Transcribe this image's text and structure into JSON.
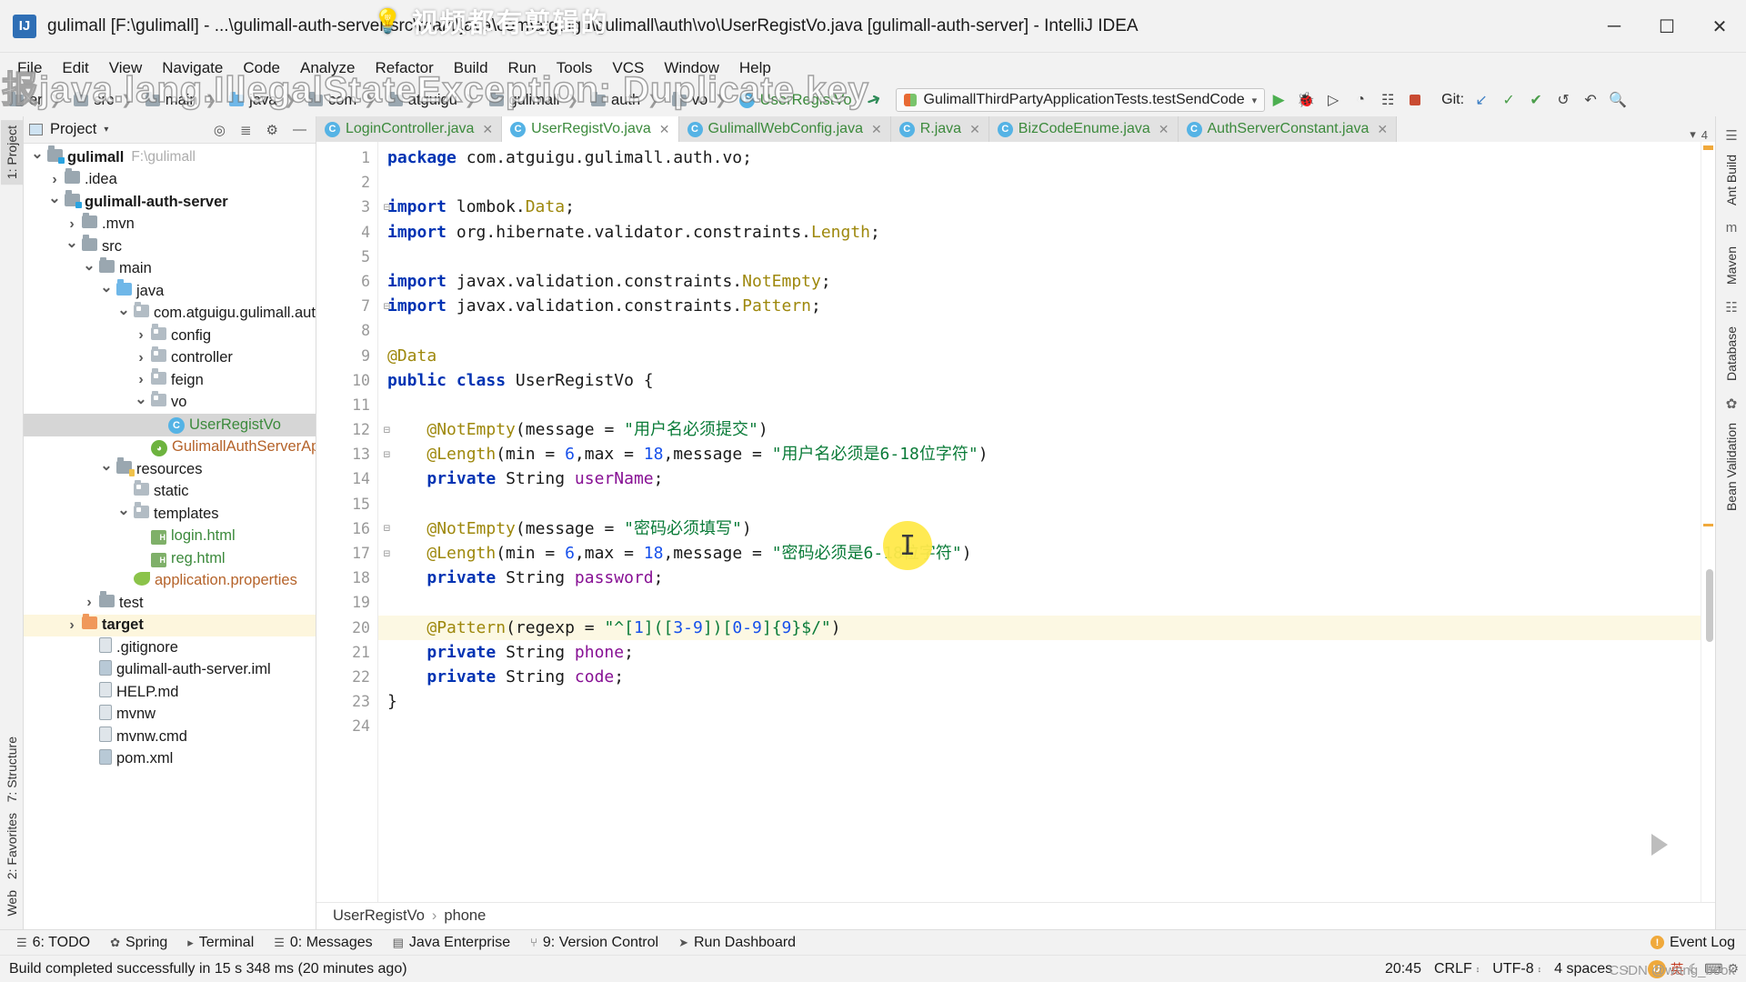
{
  "window": {
    "title": "gulimall [F:\\gulimall] - ...\\gulimall-auth-server\\src\\main\\java\\com\\atguigu\\gulimall\\auth\\vo\\UserRegistVo.java [gulimall-auth-server] - IntelliJ IDEA",
    "minimize": "─",
    "maximize": "☐",
    "close": "✕",
    "app_badge": "IJ"
  },
  "menubar": [
    "File",
    "Edit",
    "View",
    "Navigate",
    "Code",
    "Analyze",
    "Refactor",
    "Build",
    "Run",
    "Tools",
    "VCS",
    "Window",
    "Help"
  ],
  "breadcrumb": {
    "items": [
      {
        "label": "er",
        "icon": "folder-icon",
        "kind": "folder"
      },
      {
        "label": "src",
        "icon": "folder-icon",
        "kind": "folder"
      },
      {
        "label": "main",
        "icon": "folder-icon",
        "kind": "folder"
      },
      {
        "label": "java",
        "icon": "folder-blue-icon",
        "kind": "folder-blue"
      },
      {
        "label": "com",
        "icon": "folder-icon",
        "kind": "folder"
      },
      {
        "label": "atguigu",
        "icon": "folder-icon",
        "kind": "folder"
      },
      {
        "label": "gulimall",
        "icon": "folder-icon",
        "kind": "folder"
      },
      {
        "label": "auth",
        "icon": "folder-icon",
        "kind": "folder"
      },
      {
        "label": "vo",
        "icon": "folder-icon",
        "kind": "folder"
      },
      {
        "label": "UserRegistVo",
        "icon": "java-class-icon",
        "kind": "class"
      }
    ]
  },
  "toolbar": {
    "run_configuration": "GulimallThirdPartyApplicationTests.testSendCode",
    "run_caret": "▾",
    "run_label": "▶",
    "debug_label": "🐞",
    "run_coverage_label": "▷",
    "profile_label": "◔",
    "build_label": "☷",
    "stop_label": "■",
    "git_label": "Git:",
    "git_update_label": "↙",
    "git_commit_label": "✓",
    "git_push_label": "✔",
    "git_history_label": "↺",
    "git_rollback_label": "↶",
    "search_label": "🔍"
  },
  "left_strip": {
    "top_items": [
      "1: Project"
    ],
    "bottom_items": [
      "7: Structure",
      "2: Favorites",
      "Web"
    ]
  },
  "right_strip": {
    "items": [
      "Ant Build",
      "Maven",
      "Database",
      "Bean Validation"
    ]
  },
  "project_panel": {
    "header_title": "Project",
    "header_caret": "▾",
    "locate_icon": "crosshair-icon",
    "collapse_icon": "collapse-all-icon",
    "settings_icon": "gear-icon",
    "hide_icon": "minimize-icon",
    "tree": [
      {
        "label": "gulimall",
        "path": "F:\\gulimall",
        "depth": 0,
        "expand": "down",
        "icon": "module-folder-icon",
        "bold": true,
        "state": "normal"
      },
      {
        "label": ".idea",
        "path": "",
        "depth": 1,
        "expand": "right",
        "icon": "folder-icon",
        "bold": false,
        "state": "normal"
      },
      {
        "label": "gulimall-auth-server",
        "path": "",
        "depth": 1,
        "expand": "down",
        "icon": "module-folder-icon",
        "bold": true,
        "state": "normal"
      },
      {
        "label": ".mvn",
        "path": "",
        "depth": 2,
        "expand": "right",
        "icon": "folder-icon",
        "bold": false,
        "state": "normal"
      },
      {
        "label": "src",
        "path": "",
        "depth": 2,
        "expand": "down",
        "icon": "folder-icon",
        "bold": false,
        "state": "normal"
      },
      {
        "label": "main",
        "path": "",
        "depth": 3,
        "expand": "down",
        "icon": "folder-icon",
        "bold": false,
        "state": "normal"
      },
      {
        "label": "java",
        "path": "",
        "depth": 4,
        "expand": "down",
        "icon": "folder-blue-icon",
        "bold": false,
        "state": "normal"
      },
      {
        "label": "com.atguigu.gulimall.aut",
        "path": "",
        "depth": 5,
        "expand": "down",
        "icon": "package-icon",
        "bold": false,
        "state": "normal"
      },
      {
        "label": "config",
        "path": "",
        "depth": 6,
        "expand": "right",
        "icon": "package-icon",
        "bold": false,
        "state": "normal"
      },
      {
        "label": "controller",
        "path": "",
        "depth": 6,
        "expand": "right",
        "icon": "package-icon",
        "bold": false,
        "state": "normal"
      },
      {
        "label": "feign",
        "path": "",
        "depth": 6,
        "expand": "right",
        "icon": "package-icon",
        "bold": false,
        "state": "normal"
      },
      {
        "label": "vo",
        "path": "",
        "depth": 6,
        "expand": "down",
        "icon": "package-icon",
        "bold": false,
        "state": "normal"
      },
      {
        "label": "UserRegistVo",
        "path": "",
        "depth": 7,
        "expand": "none",
        "icon": "java-class-icon",
        "bold": false,
        "state": "selected"
      },
      {
        "label": "GulimallAuthServerAp",
        "path": "",
        "depth": 6,
        "expand": "none",
        "icon": "spring-boot-icon",
        "bold": false,
        "state": "spring"
      },
      {
        "label": "resources",
        "path": "",
        "depth": 4,
        "expand": "down",
        "icon": "resources-folder-icon",
        "bold": false,
        "state": "normal"
      },
      {
        "label": "static",
        "path": "",
        "depth": 5,
        "expand": "none",
        "icon": "package-icon",
        "bold": false,
        "state": "normal"
      },
      {
        "label": "templates",
        "path": "",
        "depth": 5,
        "expand": "down",
        "icon": "package-icon",
        "bold": false,
        "state": "normal"
      },
      {
        "label": "login.html",
        "path": "",
        "depth": 6,
        "expand": "none",
        "icon": "html-file-icon",
        "bold": false,
        "state": "html"
      },
      {
        "label": "reg.html",
        "path": "",
        "depth": 6,
        "expand": "none",
        "icon": "html-file-icon",
        "bold": false,
        "state": "html"
      },
      {
        "label": "application.properties",
        "path": "",
        "depth": 5,
        "expand": "none",
        "icon": "properties-file-icon",
        "bold": false,
        "state": "props"
      },
      {
        "label": "test",
        "path": "",
        "depth": 3,
        "expand": "right",
        "icon": "folder-icon",
        "bold": false,
        "state": "normal"
      },
      {
        "label": "target",
        "path": "",
        "depth": 2,
        "expand": "right",
        "icon": "folder-orange-icon",
        "bold": true,
        "state": "highlighted"
      },
      {
        "label": ".gitignore",
        "path": "",
        "depth": 3,
        "expand": "none",
        "icon": "file-icon",
        "bold": false,
        "state": "normal"
      },
      {
        "label": "gulimall-auth-server.iml",
        "path": "",
        "depth": 3,
        "expand": "none",
        "icon": "module-file-icon",
        "bold": false,
        "state": "normal"
      },
      {
        "label": "HELP.md",
        "path": "",
        "depth": 3,
        "expand": "none",
        "icon": "markdown-file-icon",
        "bold": false,
        "state": "normal"
      },
      {
        "label": "mvnw",
        "path": "",
        "depth": 3,
        "expand": "none",
        "icon": "file-icon",
        "bold": false,
        "state": "normal"
      },
      {
        "label": "mvnw.cmd",
        "path": "",
        "depth": 3,
        "expand": "none",
        "icon": "file-icon",
        "bold": false,
        "state": "normal"
      },
      {
        "label": "pom.xml",
        "path": "",
        "depth": 3,
        "expand": "none",
        "icon": "maven-file-icon",
        "bold": false,
        "state": "normal"
      }
    ]
  },
  "editor": {
    "tabs": [
      {
        "label": "LoginController.java",
        "active": false,
        "icon": "java-class-icon",
        "closable": true
      },
      {
        "label": "UserRegistVo.java",
        "active": true,
        "icon": "java-class-icon",
        "closable": true
      },
      {
        "label": "GulimallWebConfig.java",
        "active": false,
        "icon": "java-class-icon",
        "closable": true
      },
      {
        "label": "R.java",
        "active": false,
        "icon": "java-class-icon",
        "closable": true
      },
      {
        "label": "BizCodeEnume.java",
        "active": false,
        "icon": "java-class-icon",
        "closable": true
      },
      {
        "label": "AuthServerConstant.java",
        "active": false,
        "icon": "java-class-icon",
        "closable": true
      }
    ],
    "tabs_overflow_caret": "▾",
    "tabs_count_badge": "4",
    "line_numbers": [
      1,
      2,
      3,
      4,
      5,
      6,
      7,
      8,
      9,
      10,
      11,
      12,
      13,
      14,
      15,
      16,
      17,
      18,
      19,
      20,
      21,
      22,
      23,
      24
    ],
    "current_line": 20,
    "code_lines": [
      {
        "n": 1,
        "tokens": [
          {
            "t": "package ",
            "c": "kw"
          },
          {
            "t": "com.atguigu.gulimall.auth.vo;",
            "c": "pk"
          }
        ]
      },
      {
        "n": 2,
        "tokens": []
      },
      {
        "n": 3,
        "tokens": [
          {
            "t": "import ",
            "c": "kw"
          },
          {
            "t": "lombok.",
            "c": "pk"
          },
          {
            "t": "Data",
            "c": "ann"
          },
          {
            "t": ";",
            "c": "pk"
          }
        ],
        "fold": "minus"
      },
      {
        "n": 4,
        "tokens": [
          {
            "t": "import ",
            "c": "kw"
          },
          {
            "t": "org.hibernate.validator.constraints.",
            "c": "pk"
          },
          {
            "t": "Length",
            "c": "ann"
          },
          {
            "t": ";",
            "c": "pk"
          }
        ]
      },
      {
        "n": 5,
        "tokens": []
      },
      {
        "n": 6,
        "tokens": [
          {
            "t": "import ",
            "c": "kw"
          },
          {
            "t": "javax.validation.constraints.",
            "c": "pk"
          },
          {
            "t": "NotEmpty",
            "c": "ann"
          },
          {
            "t": ";",
            "c": "pk"
          }
        ]
      },
      {
        "n": 7,
        "tokens": [
          {
            "t": "import ",
            "c": "kw"
          },
          {
            "t": "javax.validation.constraints.",
            "c": "pk"
          },
          {
            "t": "Pattern",
            "c": "ann"
          },
          {
            "t": ";",
            "c": "pk"
          }
        ],
        "fold": "minus"
      },
      {
        "n": 8,
        "tokens": []
      },
      {
        "n": 9,
        "tokens": [
          {
            "t": "@Data",
            "c": "ann"
          }
        ]
      },
      {
        "n": 10,
        "tokens": [
          {
            "t": "public class ",
            "c": "kw"
          },
          {
            "t": "UserRegistVo",
            "c": "typ"
          },
          {
            "t": " {",
            "c": "pk"
          }
        ]
      },
      {
        "n": 11,
        "tokens": []
      },
      {
        "n": 12,
        "tokens": [
          {
            "t": "    ",
            "c": "pk"
          },
          {
            "t": "@NotEmpty",
            "c": "ann"
          },
          {
            "t": "(message = ",
            "c": "pk"
          },
          {
            "t": "\"用户名必须提交\"",
            "c": "str"
          },
          {
            "t": ")",
            "c": "pk"
          }
        ],
        "fold": "minus"
      },
      {
        "n": 13,
        "tokens": [
          {
            "t": "    ",
            "c": "pk"
          },
          {
            "t": "@Length",
            "c": "ann"
          },
          {
            "t": "(min = ",
            "c": "pk"
          },
          {
            "t": "6",
            "c": "num"
          },
          {
            "t": ",max = ",
            "c": "pk"
          },
          {
            "t": "18",
            "c": "num"
          },
          {
            "t": ",message = ",
            "c": "pk"
          },
          {
            "t": "\"用户名必须是6-18位字符\"",
            "c": "str"
          },
          {
            "t": ")",
            "c": "pk"
          }
        ],
        "fold": "minus"
      },
      {
        "n": 14,
        "tokens": [
          {
            "t": "    ",
            "c": "pk"
          },
          {
            "t": "private ",
            "c": "kw"
          },
          {
            "t": "String ",
            "c": "pk"
          },
          {
            "t": "userName",
            "c": "fld"
          },
          {
            "t": ";",
            "c": "pk"
          }
        ]
      },
      {
        "n": 15,
        "tokens": []
      },
      {
        "n": 16,
        "tokens": [
          {
            "t": "    ",
            "c": "pk"
          },
          {
            "t": "@NotEmpty",
            "c": "ann"
          },
          {
            "t": "(message = ",
            "c": "pk"
          },
          {
            "t": "\"密码必须填写\"",
            "c": "str"
          },
          {
            "t": ")",
            "c": "pk"
          }
        ],
        "fold": "minus"
      },
      {
        "n": 17,
        "tokens": [
          {
            "t": "    ",
            "c": "pk"
          },
          {
            "t": "@Length",
            "c": "ann"
          },
          {
            "t": "(min = ",
            "c": "pk"
          },
          {
            "t": "6",
            "c": "num"
          },
          {
            "t": ",max = ",
            "c": "pk"
          },
          {
            "t": "18",
            "c": "num"
          },
          {
            "t": ",message = ",
            "c": "pk"
          },
          {
            "t": "\"密码必须是6-18位字符\"",
            "c": "str"
          },
          {
            "t": ")",
            "c": "pk"
          }
        ],
        "fold": "minus"
      },
      {
        "n": 18,
        "tokens": [
          {
            "t": "    ",
            "c": "pk"
          },
          {
            "t": "private ",
            "c": "kw"
          },
          {
            "t": "String ",
            "c": "pk"
          },
          {
            "t": "password",
            "c": "fld"
          },
          {
            "t": ";",
            "c": "pk"
          }
        ]
      },
      {
        "n": 19,
        "tokens": []
      },
      {
        "n": 20,
        "tokens": [
          {
            "t": "    ",
            "c": "pk"
          },
          {
            "t": "@Pattern",
            "c": "ann"
          },
          {
            "t": "(regexp = ",
            "c": "pk"
          },
          {
            "t": "\"^[",
            "c": "str"
          },
          {
            "t": "1",
            "c": "num"
          },
          {
            "t": "]([",
            "c": "str"
          },
          {
            "t": "3-9",
            "c": "num"
          },
          {
            "t": "])[",
            "c": "str"
          },
          {
            "t": "0-9",
            "c": "num"
          },
          {
            "t": "]{",
            "c": "str"
          },
          {
            "t": "9",
            "c": "num"
          },
          {
            "t": "}$/\"",
            "c": "str"
          },
          {
            "t": ")",
            "c": "pk"
          }
        ],
        "highlight": true
      },
      {
        "n": 21,
        "tokens": [
          {
            "t": "    ",
            "c": "pk"
          },
          {
            "t": "private ",
            "c": "kw"
          },
          {
            "t": "String ",
            "c": "pk"
          },
          {
            "t": "phone",
            "c": "fld"
          },
          {
            "t": ";",
            "c": "pk"
          }
        ]
      },
      {
        "n": 22,
        "tokens": [
          {
            "t": "    ",
            "c": "pk"
          },
          {
            "t": "private ",
            "c": "kw"
          },
          {
            "t": "String ",
            "c": "pk"
          },
          {
            "t": "code",
            "c": "fld"
          },
          {
            "t": ";",
            "c": "pk"
          }
        ]
      },
      {
        "n": 23,
        "tokens": [
          {
            "t": "}",
            "c": "pk"
          }
        ]
      },
      {
        "n": 24,
        "tokens": []
      }
    ],
    "bottom_breadcrumb": [
      "UserRegistVo",
      "phone"
    ],
    "bottom_breadcrumb_sep": "›"
  },
  "bottom_toolwindows": [
    {
      "label": "6: TODO",
      "icon": "todo-icon"
    },
    {
      "label": "Spring",
      "icon": "spring-icon"
    },
    {
      "label": "Terminal",
      "icon": "terminal-icon"
    },
    {
      "label": "0: Messages",
      "icon": "messages-icon"
    },
    {
      "label": "Java Enterprise",
      "icon": "java-enterprise-icon"
    },
    {
      "label": "9: Version Control",
      "icon": "version-control-icon"
    },
    {
      "label": "Run Dashboard",
      "icon": "run-dashboard-icon"
    }
  ],
  "event_log": {
    "label": "Event Log",
    "badge": "!"
  },
  "statusbar": {
    "message": "Build completed successfully in 15 s 348 ms (20 minutes ago)",
    "caret_position": "20:45",
    "line_separator": "CRLF",
    "encoding": "UTF-8",
    "indent": "4 spaces",
    "caret_glyph": "↕",
    "ime_lang": "英",
    "ime_icon": "ime-icon"
  },
  "watermarks": {
    "top_text": "视频都有剪辑的",
    "big_text": "报java.lang.IllegalStateException: Duplicate key",
    "csdn": "CSDN @wang_book"
  },
  "colors": {
    "accent_blue": "#2f6fb5",
    "keyword": "#0033b3",
    "string": "#0a7b38",
    "annotation": "#9e880d",
    "number": "#1750eb",
    "field": "#871094",
    "selection_gray": "#d6d6d6",
    "highlight_yellow": "#fcf8e3",
    "target_row": "#fdf6dd",
    "cursor_blob": "#ffe94a"
  }
}
